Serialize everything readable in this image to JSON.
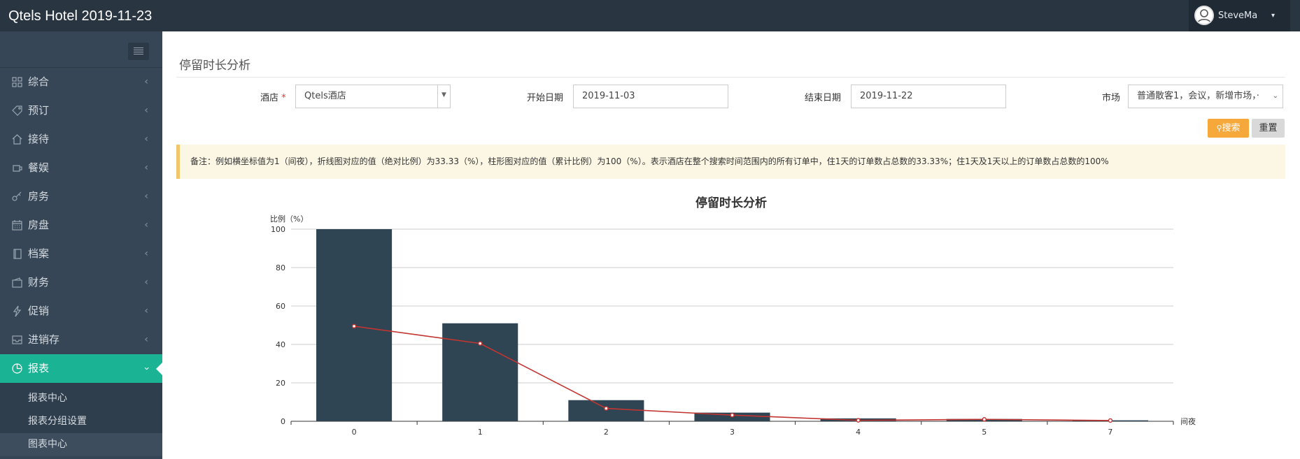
{
  "header": {
    "app_title": "Qtels Hotel 2019-11-23",
    "user_name": "SteveMa"
  },
  "sidebar": {
    "items": [
      {
        "label": "综合",
        "icon": "grid-icon",
        "arrow": "‹"
      },
      {
        "label": "预订",
        "icon": "tag-icon",
        "arrow": "‹"
      },
      {
        "label": "接待",
        "icon": "home-icon",
        "arrow": "‹"
      },
      {
        "label": "餐娱",
        "icon": "cup-icon",
        "arrow": "‹"
      },
      {
        "label": "房务",
        "icon": "key-icon",
        "arrow": "‹"
      },
      {
        "label": "房盘",
        "icon": "calendar-icon",
        "arrow": "‹"
      },
      {
        "label": "档案",
        "icon": "book-icon",
        "arrow": "‹"
      },
      {
        "label": "财务",
        "icon": "wallet-icon",
        "arrow": "‹"
      },
      {
        "label": "促销",
        "icon": "bolt-icon",
        "arrow": "‹"
      },
      {
        "label": "进销存",
        "icon": "inbox-icon",
        "arrow": "‹"
      },
      {
        "label": "报表",
        "icon": "pie-icon",
        "arrow": "›",
        "active": true
      }
    ],
    "subitems": [
      {
        "label": "报表中心"
      },
      {
        "label": "报表分组设置"
      },
      {
        "label": "图表中心",
        "current": true
      }
    ]
  },
  "page": {
    "title": "停留时长分析"
  },
  "filters": {
    "hotel_label": "酒店",
    "required_mark": "*",
    "hotel_value": "Qtels酒店",
    "start_label": "开始日期",
    "start_value": "2019-11-03",
    "end_label": "结束日期",
    "end_value": "2019-11-22",
    "market_label": "市场",
    "market_value": "普通散客1，会议，新增市场，·"
  },
  "buttons": {
    "search": "搜索",
    "reset": "重置"
  },
  "note": "备注：例如横坐标值为1（间夜），折线图对应的值（绝对比例）为33.33（%），柱形图对应的值（累计比例）为100（%）。表示酒店在整个搜索时间范围内的所有订单中，住1天的订单数占总数的33.33%；住1天及1天以上的订单数占总数的100%",
  "colors": {
    "bar": "#2f4554",
    "line": "#c23531",
    "accent": "#1ab394",
    "search_button": "#f7a83a"
  },
  "chart_data": {
    "type": "bar",
    "title": "停留时长分析",
    "ylabel": "比例（%）",
    "xlabel": "间夜",
    "ylim": [
      0,
      100
    ],
    "yticks": [
      0,
      20,
      40,
      60,
      80,
      100
    ],
    "categories": [
      "0",
      "1",
      "2",
      "3",
      "4",
      "5",
      "7"
    ],
    "series": [
      {
        "type": "bar",
        "values": [
          100,
          51,
          11,
          4.5,
          1.5,
          1.2,
          0.5
        ]
      },
      {
        "type": "line",
        "values": [
          49.5,
          40.5,
          6.7,
          3.2,
          0.5,
          1.0,
          0.4
        ]
      }
    ],
    "grid": true
  }
}
